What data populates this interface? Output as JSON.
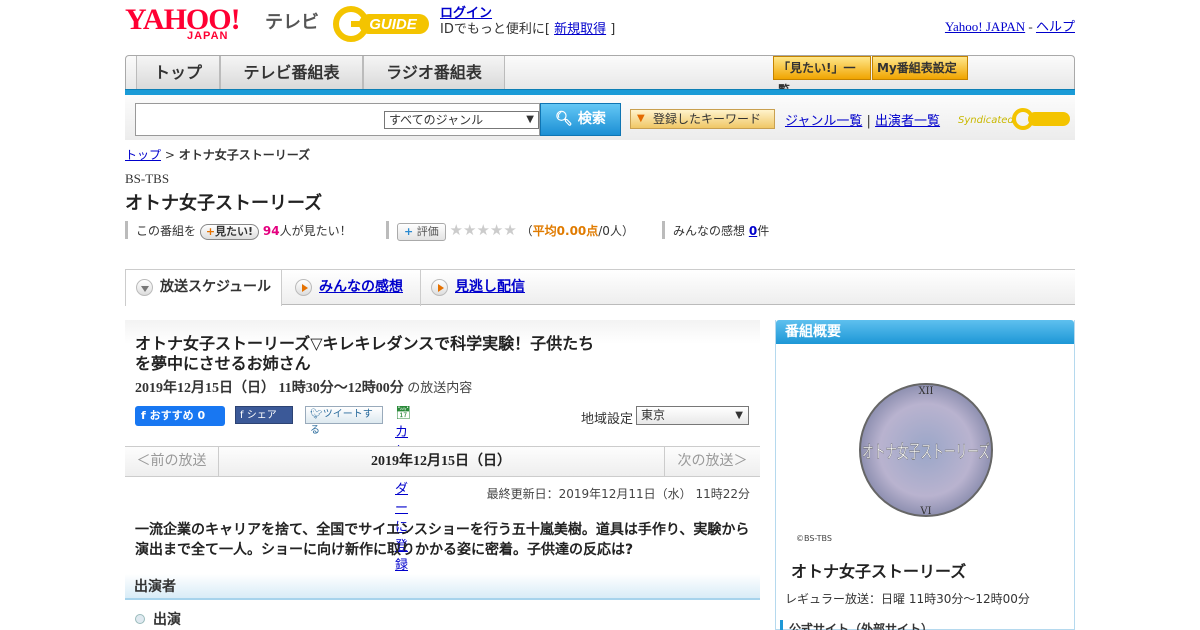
{
  "header": {
    "logo_main": "YAHOO!",
    "logo_sub": "JAPAN",
    "logo_tv": "テレビ",
    "gguide_text": "GUIDE",
    "login_label": "ログイン",
    "login_prompt": "IDでもっと便利に[",
    "register_label": "新規取得",
    "login_prompt_end": "]",
    "yahoo_japan_link": "Yahoo! JAPAN",
    "separator": "-",
    "help_link": "ヘルプ"
  },
  "nav": {
    "tabs": [
      "トップ",
      "テレビ番組表",
      "ラジオ番組表"
    ],
    "watchlist_button": "「見たい!」一覧",
    "my_schedule_button": "My番組表設定"
  },
  "search": {
    "placeholder": "",
    "genre_selected": "すべてのジャンル",
    "search_button": "検索",
    "keyword_button": "登録したキーワード",
    "genre_list_link": "ジャンル一覧",
    "divider": "|",
    "cast_list_link": "出演者一覧",
    "syndicated": "Syndicated"
  },
  "breadcrumb": {
    "top": "トップ",
    "sep": ">",
    "current": "オトナ女子ストーリーズ"
  },
  "program": {
    "channel": "BS-TBS",
    "title": "オトナ女子ストーリーズ",
    "mitai_prefix": "この番組を",
    "mitai_button": "見たい!",
    "mitai_count": "94",
    "mitai_suffix": "人が見たい！",
    "rate_button": "評価",
    "rating_open": "（",
    "rating_avg": "平均0.00点",
    "rating_people": "/0人）",
    "impressions_prefix": "みんなの感想",
    "impressions_count": "0",
    "impressions_suffix": "件"
  },
  "tabs": {
    "schedule": "放送スケジュール",
    "impressions": "みんなの感想",
    "missed": "見逃し配信"
  },
  "episode": {
    "title": "オトナ女子ストーリーズ▽キレキレダンスで科学実験！子供たちを夢中にさせるお姉さん",
    "date": "2019年12月15日（日） 11時30分～12時00分",
    "date_suffix": "の放送内容",
    "fb_recommend": "おすすめ 0",
    "fb_share": "シェア",
    "tweet": "ツイートする",
    "calendar": "カレンダーに登録",
    "region_label": "地域設定",
    "region_selected": "東京",
    "prev": "＜前の放送",
    "current_date": "2019年12月15日（日）",
    "next": "次の放送＞",
    "updated": "最終更新日：2019年12月11日（水） 11時22分",
    "description": "一流企業のキャリアを捨て、全国でサイエンスショーを行う五十嵐美樹。道具は手作り、実験から演出まで全て一人。ショーに向け新作に取りかかる姿に密着。子供達の反応は?",
    "cast_heading": "出演者",
    "cast_sub": "出演"
  },
  "sidebar": {
    "heading": "番組概要",
    "image_text": "オトナ女子ストーリーズ",
    "copyright": "©BS-TBS",
    "title": "オトナ女子ストーリーズ",
    "regular": "レギュラー放送：日曜 11時30分～12時00分",
    "official": "公式サイト（外部サイト）"
  },
  "colors": {
    "yahoo_red": "#ff0033",
    "accent_blue": "#1a9bd7",
    "link": "#0000cc",
    "count_pink": "#e4007f",
    "rating_orange": "#e07b00"
  }
}
